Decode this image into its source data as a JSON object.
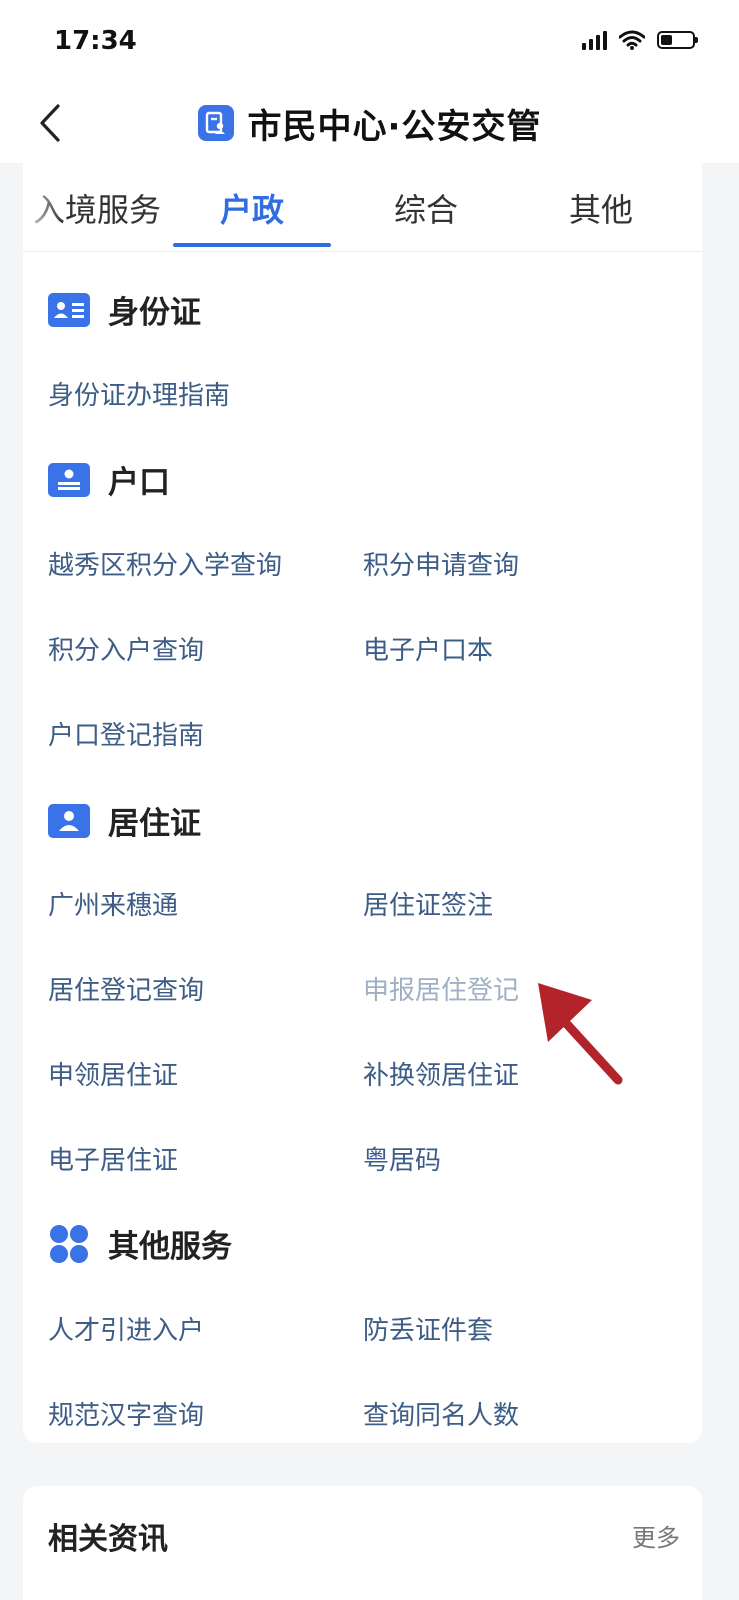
{
  "status_bar": {
    "time": "17:34"
  },
  "nav": {
    "title": "市民中心·公安交管"
  },
  "tabs": [
    {
      "label": "入境服务",
      "active": false
    },
    {
      "label": "户政",
      "active": true
    },
    {
      "label": "综合",
      "active": false
    },
    {
      "label": "其他",
      "active": false
    }
  ],
  "sections": [
    {
      "title": "身份证",
      "icon": "id-card-icon",
      "items": [
        "身份证办理指南"
      ]
    },
    {
      "title": "户口",
      "icon": "household-book-icon",
      "items": [
        "越秀区积分入学查询",
        "积分申请查询",
        "积分入户查询",
        "电子户口本",
        "户口登记指南"
      ]
    },
    {
      "title": "居住证",
      "icon": "residence-permit-icon",
      "items": [
        "广州来穗通",
        "居住证签注",
        "居住登记查询",
        "申报居住登记",
        "申领居住证",
        "补换领居住证",
        "电子居住证",
        "粤居码"
      ]
    },
    {
      "title": "其他服务",
      "icon": "grid-apps-icon",
      "items": [
        "人才引进入户",
        "防丢证件套",
        "规范汉字查询",
        "查询同名人数"
      ]
    }
  ],
  "news": {
    "title": "相关资讯",
    "more": "更多"
  },
  "colors": {
    "accent": "#2f6de0",
    "icon_blue": "#3a72e8",
    "link": "#3e5d86",
    "annotation_arrow": "#b3232a"
  }
}
